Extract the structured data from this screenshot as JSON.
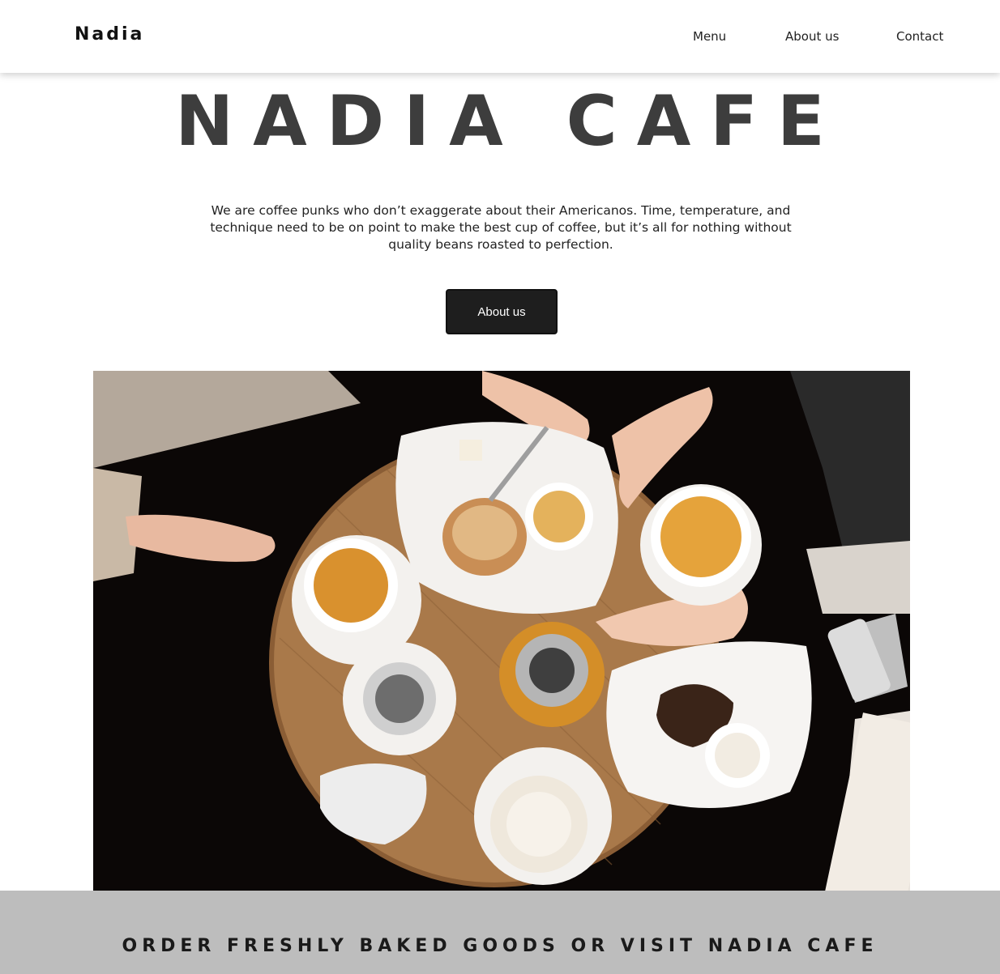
{
  "nav": {
    "brand": "Nadia",
    "links": {
      "menu": "Menu",
      "about": "About us",
      "contact": "Contact"
    }
  },
  "hero": {
    "title": "NADIA CAFE",
    "description": "We are coffee punks who don’t exaggerate about their Americanos. Time, temperature, and technique need to be on point to make the best cup of coffee, but it’s all for nothing without quality beans roasted to perfection.",
    "button_label": "About us"
  },
  "banner": {
    "text": "ORDER FRESHLY BAKED GOODS OR VISIT NADIA CAFE"
  },
  "colors": {
    "nav_bg": "#ffffff",
    "title": "#3d3d3d",
    "button_bg": "#1e1e1e",
    "banner_bg": "#bdbdbd",
    "table_wood": "#a9794a"
  }
}
